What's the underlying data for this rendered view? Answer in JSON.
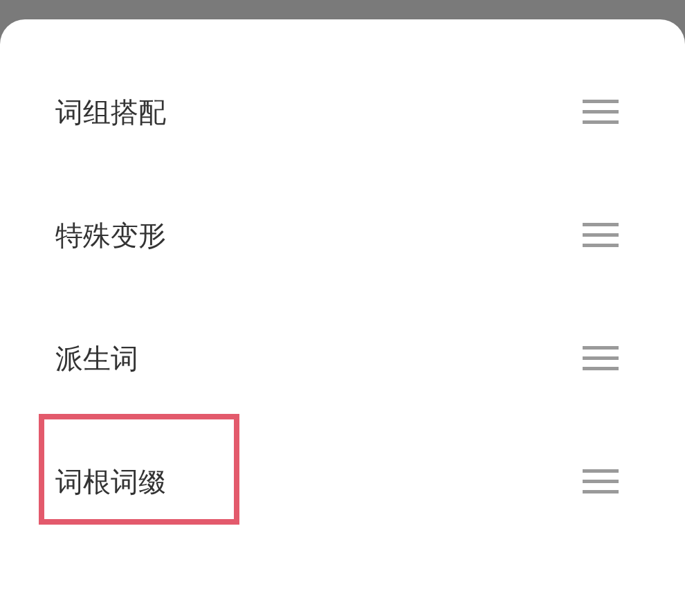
{
  "items": [
    {
      "label": "词组搭配",
      "highlighted": false
    },
    {
      "label": "特殊变形",
      "highlighted": false
    },
    {
      "label": "派生词",
      "highlighted": false
    },
    {
      "label": "词根词缀",
      "highlighted": true
    }
  ]
}
